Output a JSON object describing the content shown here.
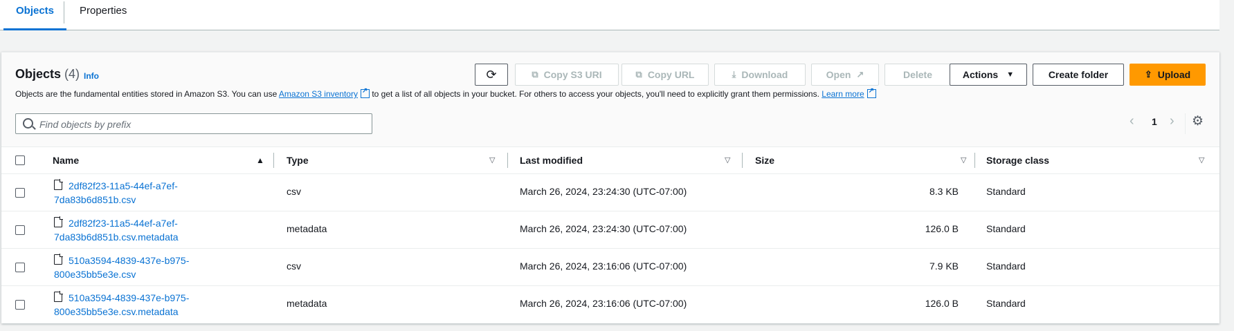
{
  "tabs": [
    {
      "label": "Objects",
      "active": true
    },
    {
      "label": "Properties",
      "active": false
    }
  ],
  "header": {
    "title": "Objects",
    "count": "(4)",
    "info": "Info",
    "description_prefix": "Objects are the fundamental entities stored in Amazon S3. You can use",
    "inventory_link": "Amazon S3 inventory",
    "description_middle": "to get a list of all objects in your bucket. For others to access your objects, you'll need to explicitly grant them permissions.",
    "learn_more": "Learn more"
  },
  "toolbar": {
    "copy_s3_uri": "Copy S3 URI",
    "copy_url": "Copy URL",
    "download": "Download",
    "open": "Open",
    "delete": "Delete",
    "actions": "Actions",
    "create_folder": "Create folder",
    "upload": "Upload"
  },
  "search": {
    "placeholder": "Find objects by prefix"
  },
  "pagination": {
    "current_page": "1"
  },
  "columns": [
    "Name",
    "Type",
    "Last modified",
    "Size",
    "Storage class"
  ],
  "rows": [
    {
      "name_line1": "2df82f23-11a5-44ef-a7ef-",
      "name_line2": "7da83b6d851b.csv",
      "type": "csv",
      "last_modified": "March 26, 2024, 23:24:30 (UTC-07:00)",
      "size": "8.3 KB",
      "storage_class": "Standard"
    },
    {
      "name_line1": "2df82f23-11a5-44ef-a7ef-",
      "name_line2": "7da83b6d851b.csv.metadata",
      "type": "metadata",
      "last_modified": "March 26, 2024, 23:24:30 (UTC-07:00)",
      "size": "126.0 B",
      "storage_class": "Standard"
    },
    {
      "name_line1": "510a3594-4839-437e-b975-",
      "name_line2": "800e35bb5e3e.csv",
      "type": "csv",
      "last_modified": "March 26, 2024, 23:16:06 (UTC-07:00)",
      "size": "7.9 KB",
      "storage_class": "Standard"
    },
    {
      "name_line1": "510a3594-4839-437e-b975-",
      "name_line2": "800e35bb5e3e.csv.metadata",
      "type": "metadata",
      "last_modified": "March 26, 2024, 23:16:06 (UTC-07:00)",
      "size": "126.0 B",
      "storage_class": "Standard"
    }
  ],
  "colors": {
    "accent": "#0972d3",
    "primary_button": "#ff9900"
  }
}
